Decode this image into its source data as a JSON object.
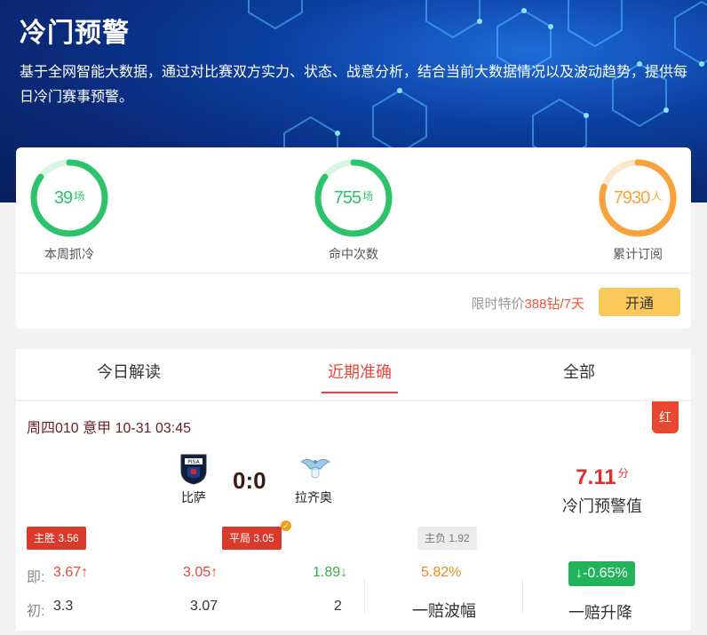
{
  "header": {
    "title": "冷门预警",
    "description": "基于全网智能大数据，通过对比赛双方实力、状态、战意分析，结合当前大数据情况以及波动趋势，提供每日冷门赛事预警。"
  },
  "stats": [
    {
      "value": "39",
      "unit": "场",
      "label": "本周抓冷",
      "color": "#2cc36b",
      "progress": 0.85
    },
    {
      "value": "755",
      "unit": "场",
      "label": "命中次数",
      "color": "#2cc36b",
      "progress": 0.85
    },
    {
      "value": "7930",
      "unit": "人",
      "label": "累计订阅",
      "color": "#f7a23b",
      "progress": 0.8
    }
  ],
  "promo": {
    "prefix": "限时特价",
    "price": "388钻/7天",
    "button": "开通"
  },
  "tabs": [
    {
      "label": "今日解读",
      "active": false
    },
    {
      "label": "近期准确",
      "active": true
    },
    {
      "label": "全部",
      "active": false
    }
  ],
  "match": {
    "meta": "周四010 意甲 10-31 03:45",
    "tag": "红",
    "home": "比萨",
    "away": "拉齐奥",
    "score": "0:0",
    "warning_value": "7.11",
    "warning_unit": "分",
    "warning_label": "冷门预警值",
    "pills": {
      "home_win": "主胜 3.56",
      "draw": "平局 3.05",
      "away_win": "主负 1.92"
    },
    "odds": {
      "now_label": "即:",
      "init_label": "初:",
      "now_home": "3.67↑",
      "now_draw": "3.05↑",
      "now_away": "1.89↓",
      "init_home": "3.3",
      "init_draw": "3.07",
      "init_away": "2"
    },
    "volatility": "5.82%",
    "volatility_label": "一赔波幅",
    "drop": "↓-0.65%",
    "drop_label": "一赔升降"
  }
}
